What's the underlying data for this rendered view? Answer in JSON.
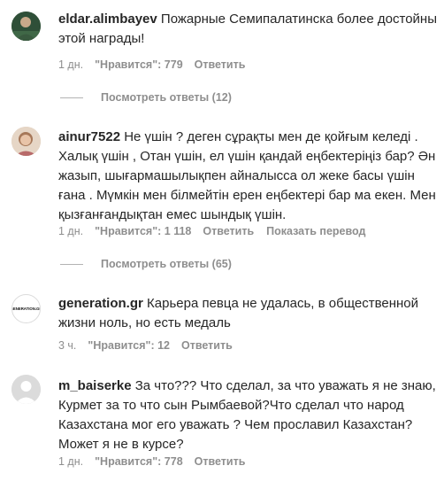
{
  "comments": [
    {
      "username": "eldar.alimbayev",
      "text": "Пожарные Семипалатинска более достойны этой награды!",
      "time": "1 дн.",
      "likes": "\"Нравится\": 779",
      "reply": "Ответить",
      "view_replies": "Посмотреть ответы (12)"
    },
    {
      "username": "ainur7522",
      "text": "Не үшін ? деген сұрақты мен де қойғым келеді . Халық үшін , Отан үшін, ел үшін қандай еңбектеріңіз бар? Ән жазып, шығармашылықпен айналысса ол жеке басы үшін ғана . Мүмкін мен білмейтін ерен еңбектері бар ма екен. Мен қызғанғандықтан емес шындық үшін.",
      "time": "1 дн.",
      "likes": "\"Нравится\": 1 118",
      "reply": "Ответить",
      "translate": "Показать перевод",
      "view_replies": "Посмотреть ответы (65)"
    },
    {
      "username": "generation.gr",
      "text": "Карьера певца не удалась, в общественной жизни ноль, но есть медаль",
      "time": "3 ч.",
      "likes": "\"Нравится\": 12",
      "reply": "Ответить",
      "avatar_text": "GENERATION.GR"
    },
    {
      "username": "m_baiserke",
      "text": "За что??? Что сделал, за что уважать я не знаю, Курмет за то что сын Рымбаевой?Что сделал что народ Казахстана мог его уважать ? Чем прославил Казахстан?Может я не в курсе?",
      "time": "1 дн.",
      "likes": "\"Нравится\": 778",
      "reply": "Ответить"
    }
  ],
  "colors": {
    "text": "#262626",
    "secondary": "#8e8e8e",
    "divider": "#b3b3b3"
  }
}
